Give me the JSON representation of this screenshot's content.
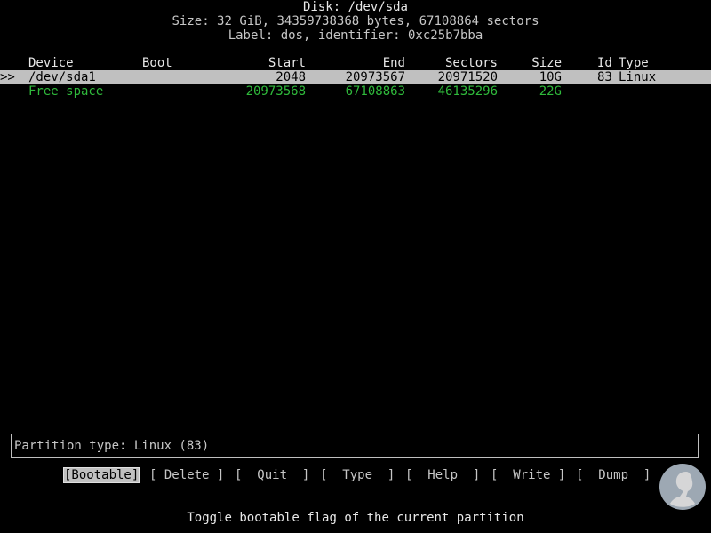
{
  "header": {
    "disk": "Disk: /dev/sda",
    "size": "Size: 32 GiB, 34359738368 bytes, 67108864 sectors",
    "label": "Label: dos, identifier: 0xc25b7bba"
  },
  "table": {
    "columns": {
      "device": "Device",
      "boot": "Boot",
      "start": "Start",
      "end": "End",
      "sectors": "Sectors",
      "size": "Size",
      "id": "Id",
      "type": "Type"
    },
    "rows": [
      {
        "marker": ">>",
        "device": "/dev/sda1",
        "boot": "",
        "start": "2048",
        "end": "20973567",
        "sectors": "20971520",
        "size": "10G",
        "id": "83",
        "type": "Linux"
      },
      {
        "marker": "",
        "device": "Free space",
        "boot": "",
        "start": "20973568",
        "end": "67108863",
        "sectors": "46135296",
        "size": "22G",
        "id": "",
        "type": ""
      }
    ]
  },
  "info": {
    "partition_type": "Partition type: Linux (83)"
  },
  "menu": {
    "bootable": "[Bootable]",
    "delete": "[ Delete ]",
    "quit": "[  Quit  ]",
    "type": "[  Type  ]",
    "help": "[  Help  ]",
    "write": "[  Write ]",
    "dump": "[  Dump  ]"
  },
  "hint": "Toggle bootable flag of the current partition",
  "colors": {
    "background": "#000000",
    "text": "#c6c6c6",
    "selected_bg": "#c0c0c0",
    "free_space": "#2fb93b"
  },
  "icons": {
    "watermark": "user-silhouette-icon"
  }
}
